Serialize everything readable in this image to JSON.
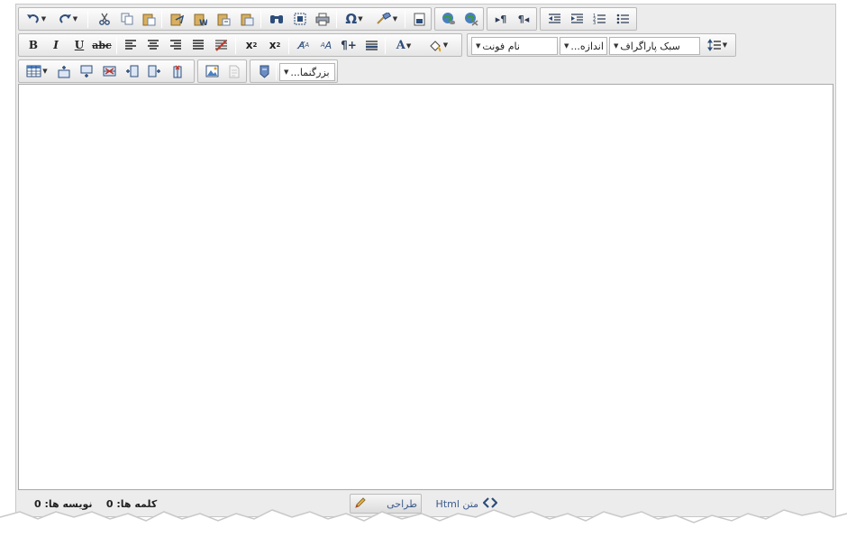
{
  "toolbar": {
    "row1": [
      "undo",
      "redo",
      "cut",
      "copy",
      "paste",
      "paste-text",
      "paste-word",
      "paste-as-html",
      "paste-html",
      "find-replace",
      "select-all",
      "print",
      "special-characters",
      "format-painter",
      "insert-snippet",
      "insert-link",
      "remove-link",
      "ltr-direction",
      "rtl-direction",
      "outdent",
      "indent",
      "ordered-list",
      "unordered-list"
    ],
    "row2": [
      "bold",
      "italic",
      "underline",
      "strikethrough",
      "align-left",
      "align-center",
      "align-right",
      "justify",
      "remove-format",
      "superscript",
      "subscript",
      "increase-font",
      "decrease-font",
      "paragraph",
      "horizontal-rule",
      "font-color",
      "highlight-color"
    ],
    "row3": [
      "insert-table",
      "insert-row-above",
      "insert-row-below",
      "delete-row",
      "insert-column-left",
      "insert-column-right",
      "delete-column",
      "insert-image",
      "insert-document",
      "insert-flash"
    ],
    "font_name_label": "نام فونت",
    "font_size_label": "اندازه...",
    "paragraph_style_label": "سبک پاراگراف",
    "zoom_label": "بزرگنما..."
  },
  "content": {
    "body_text": ""
  },
  "status": {
    "word_label": "کلمه ها:",
    "word_count": "0",
    "char_label": "نویسه ها:",
    "char_count": "0",
    "design_label": "طراحی",
    "html_label": "متن Html"
  },
  "colors": {
    "toolbar_bg": "#ececec",
    "icon_blue": "#2d4d7a",
    "link_blue": "#3c5a8c"
  }
}
